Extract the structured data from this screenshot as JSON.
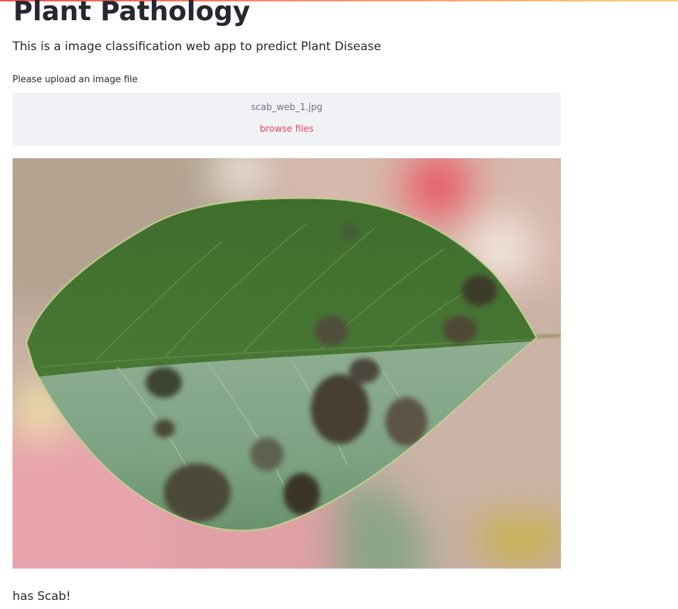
{
  "app": {
    "title": "Plant Pathology",
    "subtitle": "This is a image classification web app to predict Plant Disease"
  },
  "uploader": {
    "label": "Please upload an image file",
    "file_name": "scab_web_1.jpg",
    "browse_label": "browse files"
  },
  "image": {
    "subject": "apple-leaf-with-scab-lesions"
  },
  "result": {
    "text": "has Scab!"
  },
  "colors": {
    "accent": "#e8485a",
    "dropzone_bg": "#f0f2f6",
    "text": "#262730",
    "top_bar_start": "#ff4b4b",
    "top_bar_end": "#ffd16a"
  }
}
